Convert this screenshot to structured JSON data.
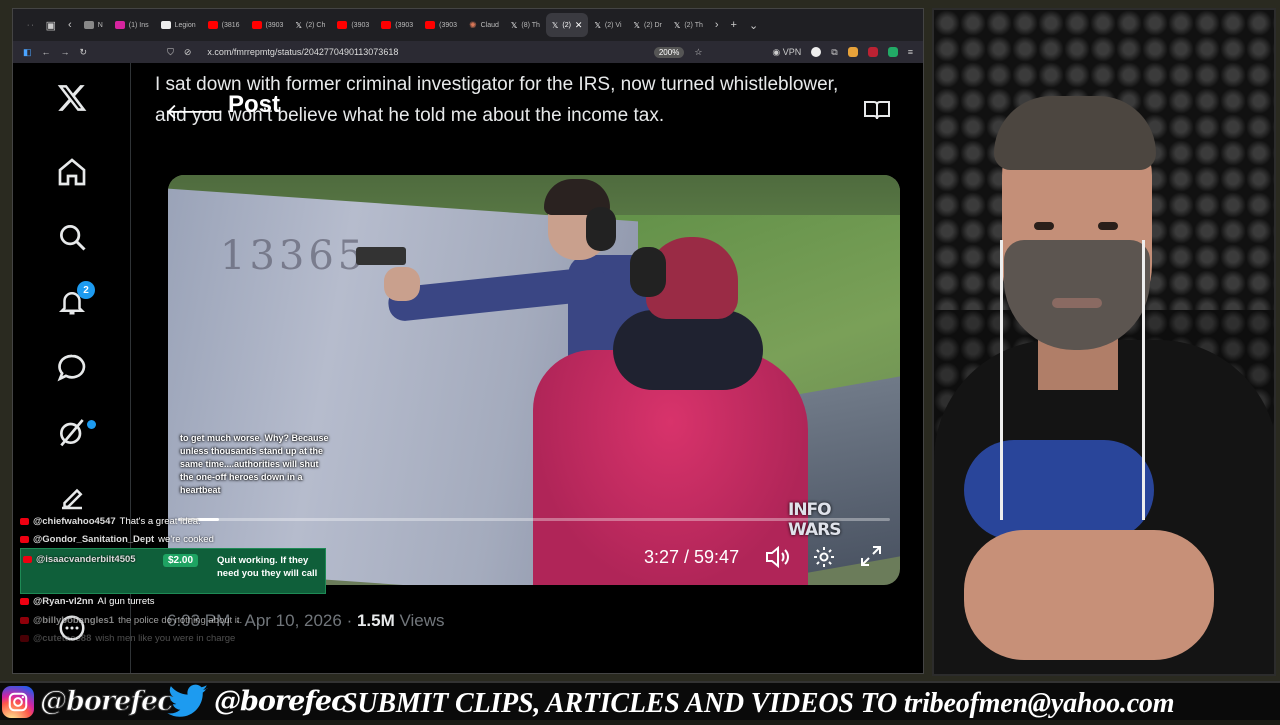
{
  "browser": {
    "tabs": [
      {
        "label": "· ·",
        "color": "#888888"
      },
      {
        "label": "N",
        "color": "#888888"
      },
      {
        "label": "(1) Ins",
        "color": "#d6249f"
      },
      {
        "label": "Legion",
        "color": "#ffffff"
      },
      {
        "label": "(3816",
        "color": "#ff0000"
      },
      {
        "label": "(3903",
        "color": "#ff0000"
      },
      {
        "label": "(2) Ch",
        "color": "#ffffff"
      },
      {
        "label": "(3903",
        "color": "#ff0000"
      },
      {
        "label": "(3903",
        "color": "#ff0000"
      },
      {
        "label": "(3903",
        "color": "#ff0000"
      },
      {
        "label": "Claud",
        "color": "#d97757"
      },
      {
        "label": "(8) Th",
        "color": "#ffffff"
      },
      {
        "label": "(2)",
        "color": "#ffffff",
        "active": true
      },
      {
        "label": "(2) Vi",
        "color": "#ffffff"
      },
      {
        "label": "(2) Dr",
        "color": "#ffffff"
      },
      {
        "label": "(2) Th",
        "color": "#ffffff"
      }
    ],
    "url": "x.com/fmrrepmtg/status/2042770490113073618",
    "zoom": "200%",
    "vpn_label": "VPN"
  },
  "sidebar": {
    "notification_count": "2",
    "icons": [
      "x-logo-icon",
      "home-icon",
      "search-icon",
      "bell-icon",
      "chat-icon",
      "grok-icon",
      "compose-icon",
      "profile-icon",
      "more-icon"
    ]
  },
  "post": {
    "title": "Post",
    "text": "I sat down with former criminal investigator for the IRS, now turned whistleblower, and you won’t believe what he told me about the income tax.",
    "timestamp": "6:03 PM · Apr 10, 2026",
    "views_count": "1.5M",
    "views_label": "Views",
    "video": {
      "time": "3:27 / 59:47",
      "progress": 0.0578,
      "watermark": "INFO WARS",
      "wall_text": "13365"
    }
  },
  "caption_overlay": "to get much worse. Why? Because unless thousands stand up at the same time....authorities will shut the one-off heroes down in a heartbeat",
  "chat": [
    {
      "user": "@chiefwahoo4547",
      "message": "That's a great idea."
    },
    {
      "user": "@Gondor_Sanitation_Dept",
      "message": "we're cooked"
    },
    {
      "user": "@isaacvanderbilt4505",
      "amount": "$2.00",
      "message": "Quit working. If they need you they will call",
      "superchat": true
    },
    {
      "user": "@Ryan-vl2nn",
      "message": "AI gun turrets"
    },
    {
      "user": "@billybobangles1",
      "message": "the police do nothing about it."
    },
    {
      "user": "@cutetace88",
      "message": "wish men like you were in charge"
    }
  ],
  "banner": {
    "instagram": "@borefec",
    "twitter": "@borefec",
    "submit": "SUBMIT CLIPS, ARTICLES AND VIDEOS TO tribeofmen@yahoo.com"
  },
  "colors": {
    "accent": "#1d9bf0",
    "superchat_bg": "#0f5f3a",
    "superchat_amount": "#1ea362"
  }
}
